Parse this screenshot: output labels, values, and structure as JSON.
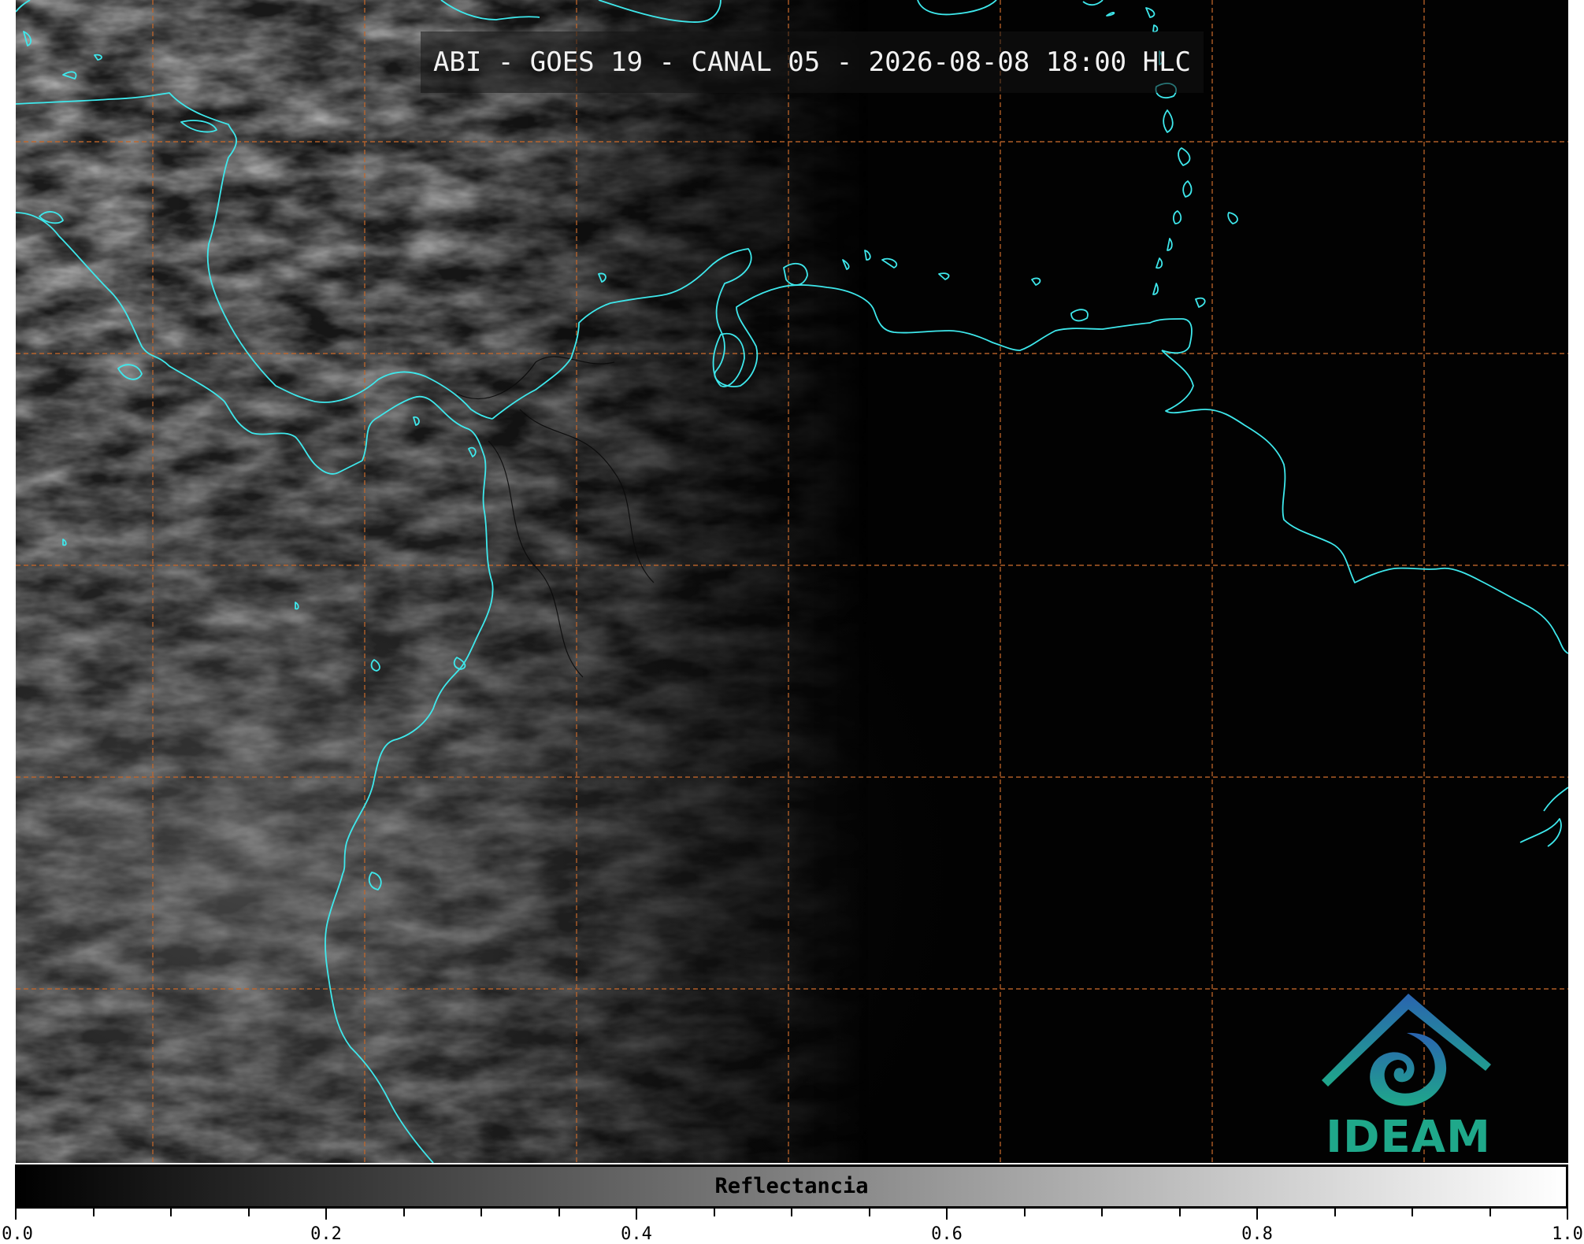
{
  "title": "ABI - GOES 19 - CANAL 05 - 2026-08-08 18:00 HLC",
  "logo": {
    "text": "IDEAM",
    "colors": [
      "#1f6fa8",
      "#1fa88a"
    ]
  },
  "colorbar": {
    "label": "Reflectancia",
    "min": 0.0,
    "max": 1.0,
    "ticks": [
      "0.0",
      "0.2",
      "0.4",
      "0.6",
      "0.8",
      "1.0"
    ],
    "minor_step": 0.05,
    "gradient": [
      "#000000",
      "#ffffff"
    ]
  },
  "map": {
    "background": "#020202",
    "coastline_color": "#3ee8ec",
    "grid_color": "#c2662a",
    "grid_style": "dashed"
  }
}
